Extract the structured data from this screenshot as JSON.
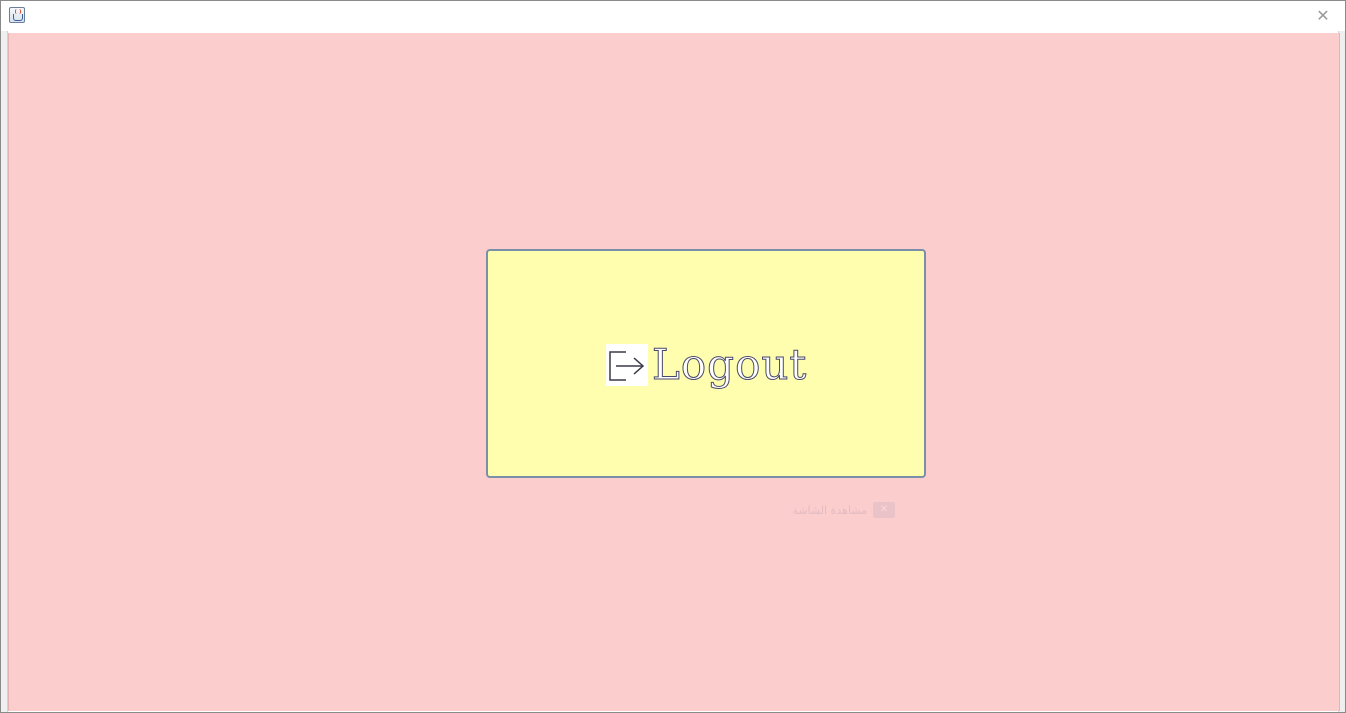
{
  "window": {
    "title": "",
    "close_glyph": "✕",
    "app_icon": "java-cup-icon"
  },
  "content": {
    "background_color": "#fccdcd"
  },
  "logout_button": {
    "label": "Logout",
    "icon": "logout-arrow-icon",
    "background_color": "#fefeae",
    "border_color": "#7a8fa8"
  },
  "ghost_tooltip": {
    "text": "مشاهدة الشاشة",
    "icon_glyph": "✕"
  }
}
